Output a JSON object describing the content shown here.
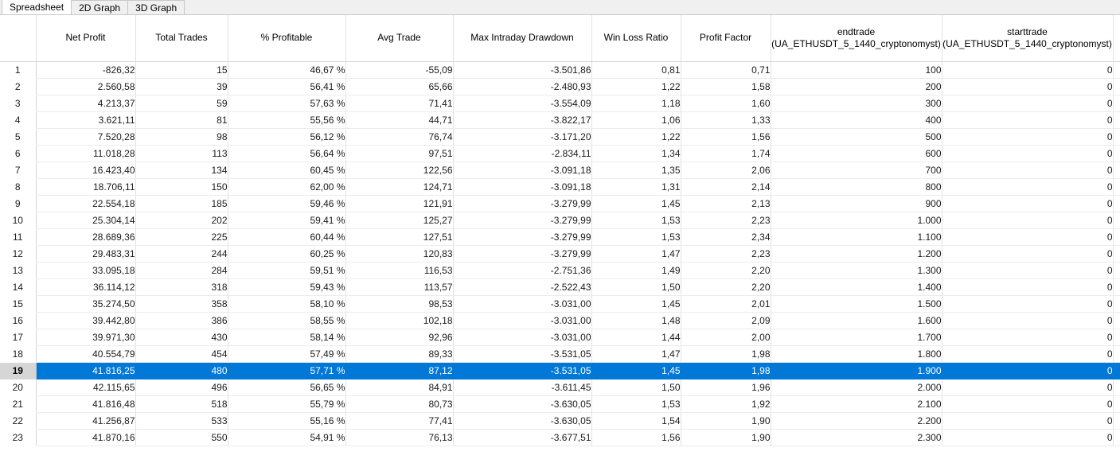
{
  "tabs": [
    {
      "label": "Spreadsheet",
      "active": true
    },
    {
      "label": "2D Graph",
      "active": false
    },
    {
      "label": "3D Graph",
      "active": false
    }
  ],
  "colors": {
    "selection_blue": "#0078d7",
    "selection_text": "#ffffff",
    "rownum_selected_bg": "#d6d6d6",
    "grid_line": "#e2e2e2",
    "tab_bar_bg": "#f0f0f0"
  },
  "grid": {
    "selected_row": 19,
    "columns": [
      {
        "key": "rownum",
        "main": "",
        "sub": ""
      },
      {
        "key": "net_profit",
        "main": "Net Profit",
        "sub": ""
      },
      {
        "key": "total_trades",
        "main": "Total Trades",
        "sub": ""
      },
      {
        "key": "pct_profitable",
        "main": "% Profitable",
        "sub": ""
      },
      {
        "key": "avg_trade",
        "main": "Avg Trade",
        "sub": ""
      },
      {
        "key": "max_dd",
        "main": "Max Intraday Drawdown",
        "sub": ""
      },
      {
        "key": "win_loss",
        "main": "Win Loss Ratio",
        "sub": ""
      },
      {
        "key": "profit_factor",
        "main": "Profit Factor",
        "sub": ""
      },
      {
        "key": "endtrade",
        "main": "endtrade",
        "sub": "(UA_ETHUSDT_5_1440_cryptonomyst)"
      },
      {
        "key": "starttrade",
        "main": "starttrade",
        "sub": "(UA_ETHUSDT_5_1440_cryptonomyst)"
      }
    ],
    "rows": [
      {
        "n": "1",
        "net_profit": "-826,32",
        "total_trades": "15",
        "pct_profitable": "46,67 %",
        "avg_trade": "-55,09",
        "max_dd": "-3.501,86",
        "win_loss": "0,81",
        "profit_factor": "0,71",
        "endtrade": "100",
        "starttrade": "0"
      },
      {
        "n": "2",
        "net_profit": "2.560,58",
        "total_trades": "39",
        "pct_profitable": "56,41 %",
        "avg_trade": "65,66",
        "max_dd": "-2.480,93",
        "win_loss": "1,22",
        "profit_factor": "1,58",
        "endtrade": "200",
        "starttrade": "0"
      },
      {
        "n": "3",
        "net_profit": "4.213,37",
        "total_trades": "59",
        "pct_profitable": "57,63 %",
        "avg_trade": "71,41",
        "max_dd": "-3.554,09",
        "win_loss": "1,18",
        "profit_factor": "1,60",
        "endtrade": "300",
        "starttrade": "0"
      },
      {
        "n": "4",
        "net_profit": "3.621,11",
        "total_trades": "81",
        "pct_profitable": "55,56 %",
        "avg_trade": "44,71",
        "max_dd": "-3.822,17",
        "win_loss": "1,06",
        "profit_factor": "1,33",
        "endtrade": "400",
        "starttrade": "0"
      },
      {
        "n": "5",
        "net_profit": "7.520,28",
        "total_trades": "98",
        "pct_profitable": "56,12 %",
        "avg_trade": "76,74",
        "max_dd": "-3.171,20",
        "win_loss": "1,22",
        "profit_factor": "1,56",
        "endtrade": "500",
        "starttrade": "0"
      },
      {
        "n": "6",
        "net_profit": "11.018,28",
        "total_trades": "113",
        "pct_profitable": "56,64 %",
        "avg_trade": "97,51",
        "max_dd": "-2.834,11",
        "win_loss": "1,34",
        "profit_factor": "1,74",
        "endtrade": "600",
        "starttrade": "0"
      },
      {
        "n": "7",
        "net_profit": "16.423,40",
        "total_trades": "134",
        "pct_profitable": "60,45 %",
        "avg_trade": "122,56",
        "max_dd": "-3.091,18",
        "win_loss": "1,35",
        "profit_factor": "2,06",
        "endtrade": "700",
        "starttrade": "0"
      },
      {
        "n": "8",
        "net_profit": "18.706,11",
        "total_trades": "150",
        "pct_profitable": "62,00 %",
        "avg_trade": "124,71",
        "max_dd": "-3.091,18",
        "win_loss": "1,31",
        "profit_factor": "2,14",
        "endtrade": "800",
        "starttrade": "0"
      },
      {
        "n": "9",
        "net_profit": "22.554,18",
        "total_trades": "185",
        "pct_profitable": "59,46 %",
        "avg_trade": "121,91",
        "max_dd": "-3.279,99",
        "win_loss": "1,45",
        "profit_factor": "2,13",
        "endtrade": "900",
        "starttrade": "0"
      },
      {
        "n": "10",
        "net_profit": "25.304,14",
        "total_trades": "202",
        "pct_profitable": "59,41 %",
        "avg_trade": "125,27",
        "max_dd": "-3.279,99",
        "win_loss": "1,53",
        "profit_factor": "2,23",
        "endtrade": "1.000",
        "starttrade": "0"
      },
      {
        "n": "11",
        "net_profit": "28.689,36",
        "total_trades": "225",
        "pct_profitable": "60,44 %",
        "avg_trade": "127,51",
        "max_dd": "-3.279,99",
        "win_loss": "1,53",
        "profit_factor": "2,34",
        "endtrade": "1.100",
        "starttrade": "0"
      },
      {
        "n": "12",
        "net_profit": "29.483,31",
        "total_trades": "244",
        "pct_profitable": "60,25 %",
        "avg_trade": "120,83",
        "max_dd": "-3.279,99",
        "win_loss": "1,47",
        "profit_factor": "2,23",
        "endtrade": "1.200",
        "starttrade": "0"
      },
      {
        "n": "13",
        "net_profit": "33.095,18",
        "total_trades": "284",
        "pct_profitable": "59,51 %",
        "avg_trade": "116,53",
        "max_dd": "-2.751,36",
        "win_loss": "1,49",
        "profit_factor": "2,20",
        "endtrade": "1.300",
        "starttrade": "0"
      },
      {
        "n": "14",
        "net_profit": "36.114,12",
        "total_trades": "318",
        "pct_profitable": "59,43 %",
        "avg_trade": "113,57",
        "max_dd": "-2.522,43",
        "win_loss": "1,50",
        "profit_factor": "2,20",
        "endtrade": "1.400",
        "starttrade": "0"
      },
      {
        "n": "15",
        "net_profit": "35.274,50",
        "total_trades": "358",
        "pct_profitable": "58,10 %",
        "avg_trade": "98,53",
        "max_dd": "-3.031,00",
        "win_loss": "1,45",
        "profit_factor": "2,01",
        "endtrade": "1.500",
        "starttrade": "0"
      },
      {
        "n": "16",
        "net_profit": "39.442,80",
        "total_trades": "386",
        "pct_profitable": "58,55 %",
        "avg_trade": "102,18",
        "max_dd": "-3.031,00",
        "win_loss": "1,48",
        "profit_factor": "2,09",
        "endtrade": "1.600",
        "starttrade": "0"
      },
      {
        "n": "17",
        "net_profit": "39.971,30",
        "total_trades": "430",
        "pct_profitable": "58,14 %",
        "avg_trade": "92,96",
        "max_dd": "-3.031,00",
        "win_loss": "1,44",
        "profit_factor": "2,00",
        "endtrade": "1.700",
        "starttrade": "0"
      },
      {
        "n": "18",
        "net_profit": "40.554,79",
        "total_trades": "454",
        "pct_profitable": "57,49 %",
        "avg_trade": "89,33",
        "max_dd": "-3.531,05",
        "win_loss": "1,47",
        "profit_factor": "1,98",
        "endtrade": "1.800",
        "starttrade": "0"
      },
      {
        "n": "19",
        "net_profit": "41.816,25",
        "total_trades": "480",
        "pct_profitable": "57,71 %",
        "avg_trade": "87,12",
        "max_dd": "-3.531,05",
        "win_loss": "1,45",
        "profit_factor": "1,98",
        "endtrade": "1.900",
        "starttrade": "0",
        "selected": true
      },
      {
        "n": "20",
        "net_profit": "42.115,65",
        "total_trades": "496",
        "pct_profitable": "56,65 %",
        "avg_trade": "84,91",
        "max_dd": "-3.611,45",
        "win_loss": "1,50",
        "profit_factor": "1,96",
        "endtrade": "2.000",
        "starttrade": "0"
      },
      {
        "n": "21",
        "net_profit": "41.816,48",
        "total_trades": "518",
        "pct_profitable": "55,79 %",
        "avg_trade": "80,73",
        "max_dd": "-3.630,05",
        "win_loss": "1,53",
        "profit_factor": "1,92",
        "endtrade": "2.100",
        "starttrade": "0"
      },
      {
        "n": "22",
        "net_profit": "41.256,87",
        "total_trades": "533",
        "pct_profitable": "55,16 %",
        "avg_trade": "77,41",
        "max_dd": "-3.630,05",
        "win_loss": "1,54",
        "profit_factor": "1,90",
        "endtrade": "2.200",
        "starttrade": "0"
      },
      {
        "n": "23",
        "net_profit": "41.870,16",
        "total_trades": "550",
        "pct_profitable": "54,91 %",
        "avg_trade": "76,13",
        "max_dd": "-3.677,51",
        "win_loss": "1,56",
        "profit_factor": "1,90",
        "endtrade": "2.300",
        "starttrade": "0"
      }
    ]
  }
}
